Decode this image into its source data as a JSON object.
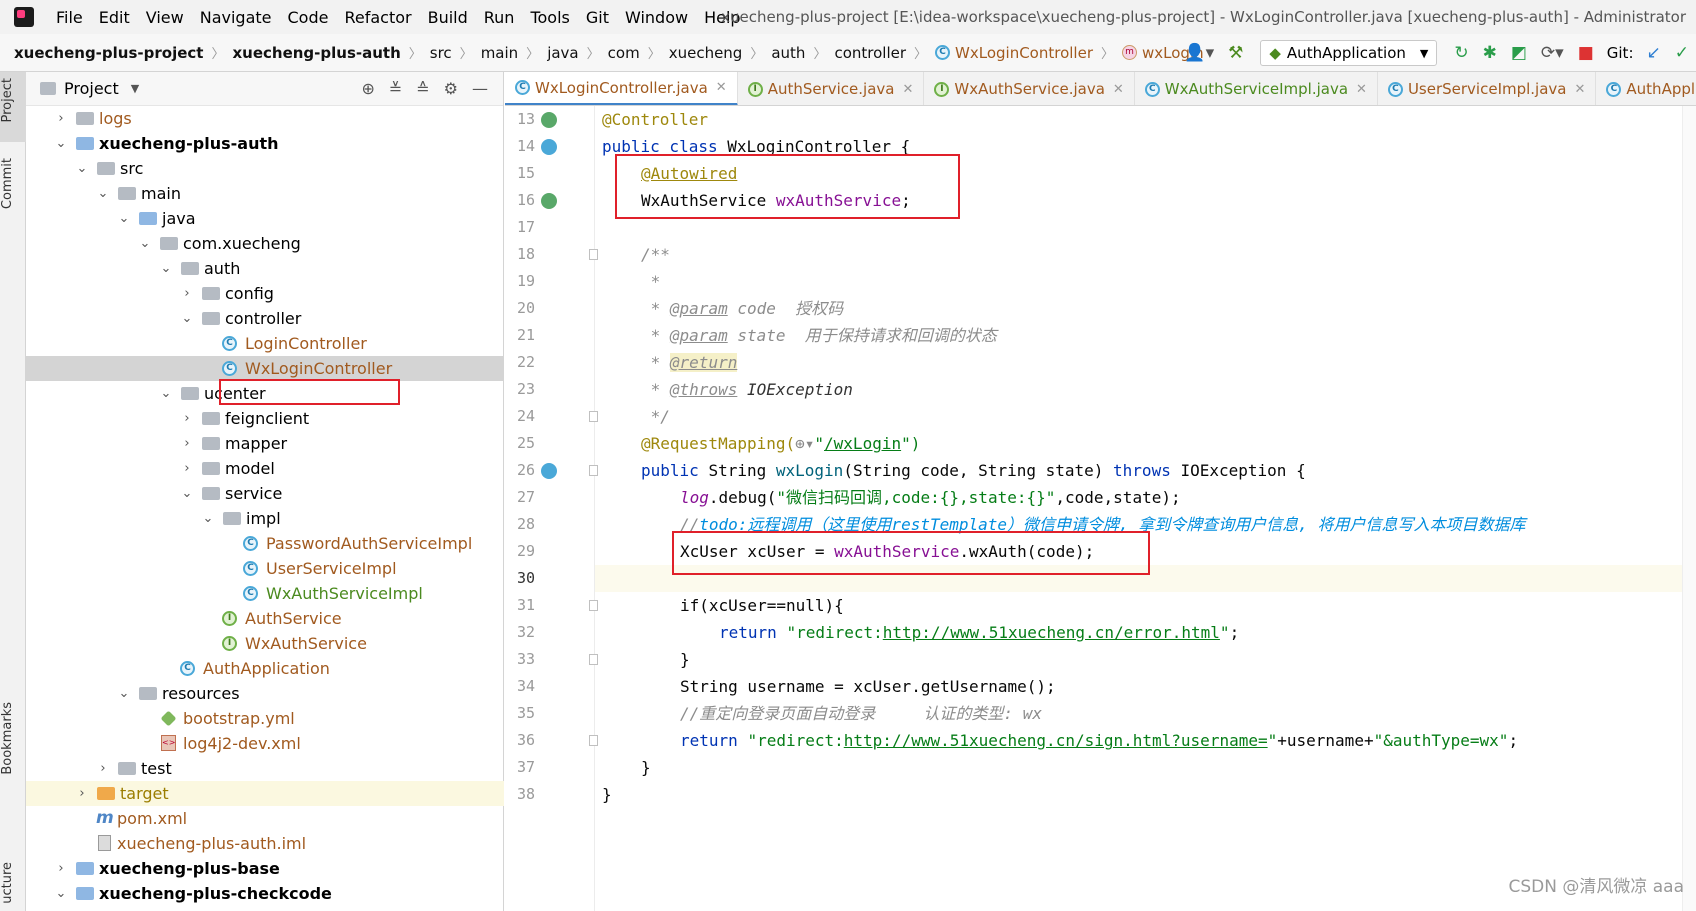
{
  "menubar": {
    "items": [
      "File",
      "Edit",
      "View",
      "Navigate",
      "Code",
      "Refactor",
      "Build",
      "Run",
      "Tools",
      "Git",
      "Window",
      "Help"
    ],
    "window_title": "xuecheng-plus-project [E:\\idea-workspace\\xuecheng-plus-project] - WxLoginController.java [xuecheng-plus-auth] - Administrator"
  },
  "navbar": {
    "breadcrumbs": [
      "xuecheng-plus-project",
      "xuecheng-plus-auth",
      "src",
      "main",
      "java",
      "com",
      "xuecheng",
      "auth",
      "controller",
      "WxLoginController",
      "wxLogin"
    ],
    "run_config": "AuthApplication",
    "git_label": "Git:"
  },
  "left_strip": {
    "project": "Project",
    "commit": "Commit",
    "bookmarks": "Bookmarks",
    "structure": "ucture"
  },
  "project_panel": {
    "title": "Project",
    "tree": [
      {
        "label": "logs"
      },
      {
        "label": "xuecheng-plus-auth"
      },
      {
        "label": "src"
      },
      {
        "label": "main"
      },
      {
        "label": "java"
      },
      {
        "label": "com.xuecheng"
      },
      {
        "label": "auth"
      },
      {
        "label": "config"
      },
      {
        "label": "controller"
      },
      {
        "label": "LoginController"
      },
      {
        "label": "WxLoginController"
      },
      {
        "label": "ucenter"
      },
      {
        "label": "feignclient"
      },
      {
        "label": "mapper"
      },
      {
        "label": "model"
      },
      {
        "label": "service"
      },
      {
        "label": "impl"
      },
      {
        "label": "PasswordAuthServiceImpl"
      },
      {
        "label": "UserServiceImpl"
      },
      {
        "label": "WxAuthServiceImpl"
      },
      {
        "label": "AuthService"
      },
      {
        "label": "WxAuthService"
      },
      {
        "label": "AuthApplication"
      },
      {
        "label": "resources"
      },
      {
        "label": "bootstrap.yml"
      },
      {
        "label": "log4j2-dev.xml"
      },
      {
        "label": "test"
      },
      {
        "label": "target"
      },
      {
        "label": "pom.xml"
      },
      {
        "label": "xuecheng-plus-auth.iml"
      },
      {
        "label": "xuecheng-plus-base"
      },
      {
        "label": "xuecheng-plus-checkcode"
      }
    ]
  },
  "editor_tabs": [
    {
      "label": "WxLoginController.java"
    },
    {
      "label": "AuthService.java"
    },
    {
      "label": "WxAuthService.java"
    },
    {
      "label": "WxAuthServiceImpl.java"
    },
    {
      "label": "UserServiceImpl.java"
    },
    {
      "label": "AuthApplica"
    }
  ],
  "editor": {
    "line_numbers": [
      "13",
      "14",
      "15",
      "16",
      "17",
      "18",
      "19",
      "20",
      "21",
      "22",
      "23",
      "24",
      "25",
      "26",
      "27",
      "28",
      "29",
      "30",
      "31",
      "32",
      "33",
      "34",
      "35",
      "36",
      "37",
      "38"
    ],
    "code": {
      "l13_ann": "@Controller",
      "l14_kw1": "public class ",
      "l14_name": "WxLoginController {",
      "l15_ann": "@Autowired",
      "l16_type": "WxAuthService ",
      "l16_field": "wxAuthService",
      "l16_end": ";",
      "l18": "/**",
      "l19": " *",
      "l20_star": " * ",
      "l20_tag": "@param",
      "l20_rest": " code  授权码",
      "l21_star": " * ",
      "l21_tag": "@param",
      "l21_rest": " state  用于保持请求和回调的状态",
      "l22_star": " * ",
      "l22_tag": "@return",
      "l23_star": " * ",
      "l23_tag": "@throws",
      "l23_rest": " IOException",
      "l24": " */",
      "l25_ann": "@RequestMapping(",
      "l25_q1": "\"",
      "l25_url": "/wxLogin",
      "l25_end": "\")",
      "l26_kw1": "public ",
      "l26_t1": "String ",
      "l26_m": "wxLogin",
      "l26_args": "(String code, String state) ",
      "l26_kw2": "throws ",
      "l26_ex": "IOException {",
      "l27_fld": "log",
      "l27_call": ".debug(",
      "l27_str": "\"微信扫码回调,code:{},state:{}\"",
      "l27_end": ",code,state);",
      "l28_pre": "//",
      "l28_todo": "todo:远程调用（这里使用restTemplate）微信申请令牌, 拿到令牌查询用户信息, 将用户信息写入本项目数据库",
      "l29_pre": "XcUser xcUser = ",
      "l29_fld": "wxAuthService",
      "l29_end": ".wxAuth(code);",
      "l31": "if(xcUser==null){",
      "l32_kw": "return ",
      "l32_s1": "\"redirect:",
      "l32_url": "http://www.51xuecheng.cn/error.html",
      "l32_s2": "\"",
      "l32_end": ";",
      "l33": "}",
      "l34": "String username = xcUser.getUsername();",
      "l35": "//重定向登录页面自动登录     认证的类型: wx",
      "l36_kw": "return ",
      "l36_s1": "\"redirect:",
      "l36_url": "http://www.51xuecheng.cn/sign.html?username=",
      "l36_s2": "\"",
      "l36_mid": "+username+",
      "l36_s3": "\"&authType=wx\"",
      "l36_end": ";",
      "l37": "}",
      "l38": "}"
    }
  },
  "watermark": "CSDN @清风微凉 aaa",
  "colors": {
    "highlight_box": "#e0202a",
    "keyword": "#0033b3",
    "annotation": "#9e880d",
    "field": "#871094",
    "string": "#067d17",
    "todo": "#008dde"
  }
}
